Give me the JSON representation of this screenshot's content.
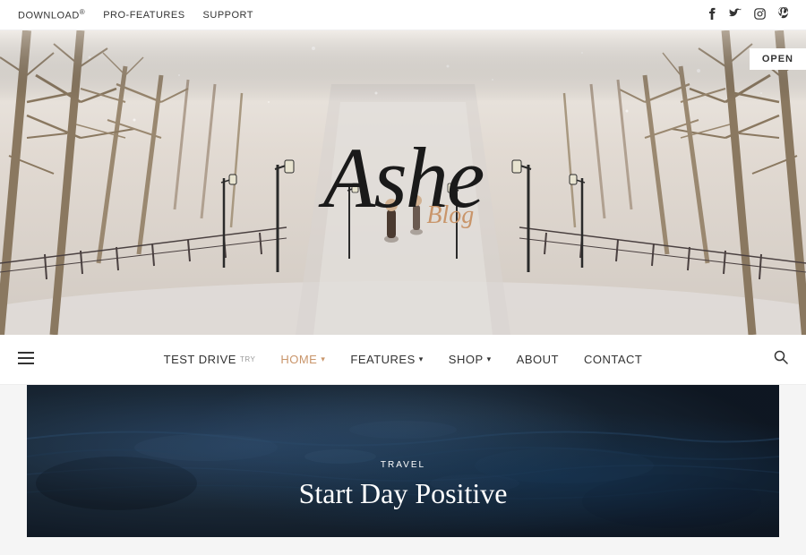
{
  "topbar": {
    "links": [
      {
        "label": "DOWNLOAD",
        "sup": "®"
      },
      {
        "label": "PRO-FEATURES"
      },
      {
        "label": "SUPPORT"
      }
    ],
    "social": [
      {
        "name": "facebook",
        "icon": "f"
      },
      {
        "name": "twitter",
        "icon": "t"
      },
      {
        "name": "instagram",
        "icon": "i"
      },
      {
        "name": "pinterest",
        "icon": "p"
      }
    ]
  },
  "hero": {
    "title": "Ashe",
    "subtitle": "Blog",
    "open_button": "OPEN"
  },
  "navbar": {
    "items": [
      {
        "label": "TEST DRIVE",
        "sup": "TRY",
        "active": false,
        "has_dropdown": false
      },
      {
        "label": "HOME",
        "active": true,
        "has_dropdown": true
      },
      {
        "label": "FEATURES",
        "active": false,
        "has_dropdown": true
      },
      {
        "label": "SHOP",
        "active": false,
        "has_dropdown": true
      },
      {
        "label": "ABOUT",
        "active": false,
        "has_dropdown": false
      },
      {
        "label": "CONTACT",
        "active": false,
        "has_dropdown": false
      }
    ]
  },
  "featured_post": {
    "category": "TRAVEL",
    "title": "Start Day Positive"
  },
  "colors": {
    "accent": "#c9956a",
    "nav_active": "#c9956a",
    "text_dark": "#1a1a1a",
    "text_light": "#fff"
  }
}
